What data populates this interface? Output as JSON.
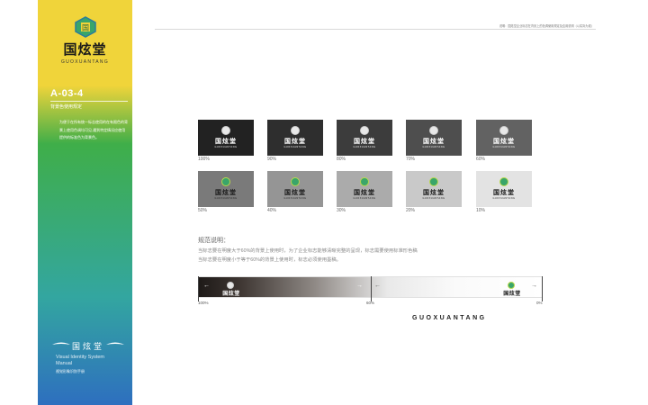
{
  "brand": {
    "name_cn": "国炫堂",
    "name_en": "GUOXUANTANG",
    "emblem_center": "国"
  },
  "page": {
    "code": "A-03-4",
    "subtitle": "背景色使用规定",
    "description": "为便于在所有统一标志使用的在有限色的背景上使用色调均可见,遇到特定情况应使用提供的标准色为背景色。",
    "top_note": "说明：国炫堂企业标志在背景上的色调使用规定及应用说明（以实际为准）"
  },
  "footer": {
    "logo_text": "国炫堂",
    "line1": "Visual Identity System",
    "line2": "Manual",
    "line3": "视觉形象识别手册"
  },
  "swatches": {
    "row1": [
      {
        "label": "100%",
        "bg": "#222222",
        "text": "#ffffff",
        "emblem": "light"
      },
      {
        "label": "90%",
        "bg": "#2e2e2e",
        "text": "#ffffff",
        "emblem": "light"
      },
      {
        "label": "80%",
        "bg": "#3c3c3c",
        "text": "#ffffff",
        "emblem": "light"
      },
      {
        "label": "70%",
        "bg": "#4e4e4e",
        "text": "#ffffff",
        "emblem": "light"
      },
      {
        "label": "60%",
        "bg": "#626262",
        "text": "#ffffff",
        "emblem": "light"
      }
    ],
    "row2": [
      {
        "label": "50%",
        "bg": "#7a7a7a",
        "text": "#1a1a1a",
        "emblem": "color"
      },
      {
        "label": "40%",
        "bg": "#959595",
        "text": "#1a1a1a",
        "emblem": "color"
      },
      {
        "label": "30%",
        "bg": "#ababab",
        "text": "#1a1a1a",
        "emblem": "color"
      },
      {
        "label": "20%",
        "bg": "#c9c9c9",
        "text": "#1a1a1a",
        "emblem": "color"
      },
      {
        "label": "10%",
        "bg": "#e3e3e3",
        "text": "#1a1a1a",
        "emblem": "color"
      }
    ]
  },
  "rules": {
    "title": "规范说明：",
    "line1": "当标志要在明度大于60%的背景上使用时，为了企业标志能够清晰完整的呈现，标志需要使用标准形色稿",
    "line2": "当标志要在明度小于等于60%的背景上使用时，标志必须使用墨稿。"
  },
  "gradient": {
    "left_label": "100%",
    "mid_label": "60%",
    "right_label": "0%",
    "left_arrow": "←",
    "mid_arrow": "→",
    "mid_left_arrow": "←",
    "right_arrow": "→"
  },
  "bottom_en": "GUOXUANTANG"
}
